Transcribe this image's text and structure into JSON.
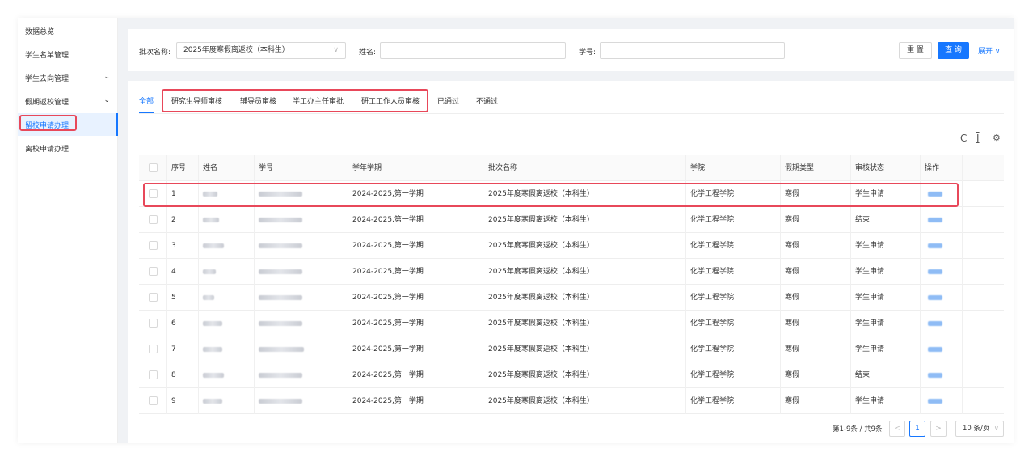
{
  "sidebar": {
    "items": [
      {
        "label": "数据总览",
        "expandable": false
      },
      {
        "label": "学生名单管理",
        "expandable": false
      },
      {
        "label": "学生去向管理",
        "expandable": true
      },
      {
        "label": "假期返校管理",
        "expandable": true
      },
      {
        "label": "留校申请办理",
        "expandable": false,
        "active": true
      },
      {
        "label": "离校申请办理",
        "expandable": false
      }
    ],
    "chevron": "⌄"
  },
  "search": {
    "batch_label": "批次名称:",
    "batch_value": "2025年度寒假离返校（本科生）",
    "name_label": "姓名:",
    "name_value": "",
    "id_label": "学号:",
    "id_value": "",
    "reset_label": "重 置",
    "query_label": "查 询",
    "expand_label": "展开 ∨",
    "select_arrow": "∨"
  },
  "tabs": [
    "全部",
    "研究生导师审核",
    "辅导员审核",
    "学工办主任审批",
    "研工工作人员审核",
    "已通过",
    "不通过"
  ],
  "toolbar": {
    "refresh_icon": "C",
    "density_icon": "I",
    "settings_icon": "⚙"
  },
  "table": {
    "columns": [
      "序号",
      "姓名",
      "学号",
      "学年学期",
      "批次名称",
      "学院",
      "假期类型",
      "审核状态",
      "操作"
    ],
    "rows": [
      {
        "index": "1",
        "term": "2024-2025,第一学期",
        "batch": "2025年度寒假离返校（本科生）",
        "college": "化学工程学院",
        "holiday": "寒假",
        "status": "学生申请"
      },
      {
        "index": "2",
        "term": "2024-2025,第一学期",
        "batch": "2025年度寒假离返校（本科生）",
        "college": "化学工程学院",
        "holiday": "寒假",
        "status": "结束"
      },
      {
        "index": "3",
        "term": "2024-2025,第一学期",
        "batch": "2025年度寒假离返校（本科生）",
        "college": "化学工程学院",
        "holiday": "寒假",
        "status": "学生申请"
      },
      {
        "index": "4",
        "term": "2024-2025,第一学期",
        "batch": "2025年度寒假离返校（本科生）",
        "college": "化学工程学院",
        "holiday": "寒假",
        "status": "学生申请"
      },
      {
        "index": "5",
        "term": "2024-2025,第一学期",
        "batch": "2025年度寒假离返校（本科生）",
        "college": "化学工程学院",
        "holiday": "寒假",
        "status": "学生申请"
      },
      {
        "index": "6",
        "term": "2024-2025,第一学期",
        "batch": "2025年度寒假离返校（本科生）",
        "college": "化学工程学院",
        "holiday": "寒假",
        "status": "学生申请"
      },
      {
        "index": "7",
        "term": "2024-2025,第一学期",
        "batch": "2025年度寒假离返校（本科生）",
        "college": "化学工程学院",
        "holiday": "寒假",
        "status": "学生申请"
      },
      {
        "index": "8",
        "term": "2024-2025,第一学期",
        "batch": "2025年度寒假离返校（本科生）",
        "college": "化学工程学院",
        "holiday": "寒假",
        "status": "结束"
      },
      {
        "index": "9",
        "term": "2024-2025,第一学期",
        "batch": "2025年度寒假离返校（本科生）",
        "college": "化学工程学院",
        "holiday": "寒假",
        "status": "学生申请"
      }
    ]
  },
  "pagination": {
    "total_text": "第1-9条 / 共9条",
    "prev": "<",
    "current": "1",
    "next": ">",
    "page_size": "10 条/页",
    "size_arrow": "∨"
  },
  "colors": {
    "accent": "#1677ff",
    "highlight": "#e8485a"
  }
}
